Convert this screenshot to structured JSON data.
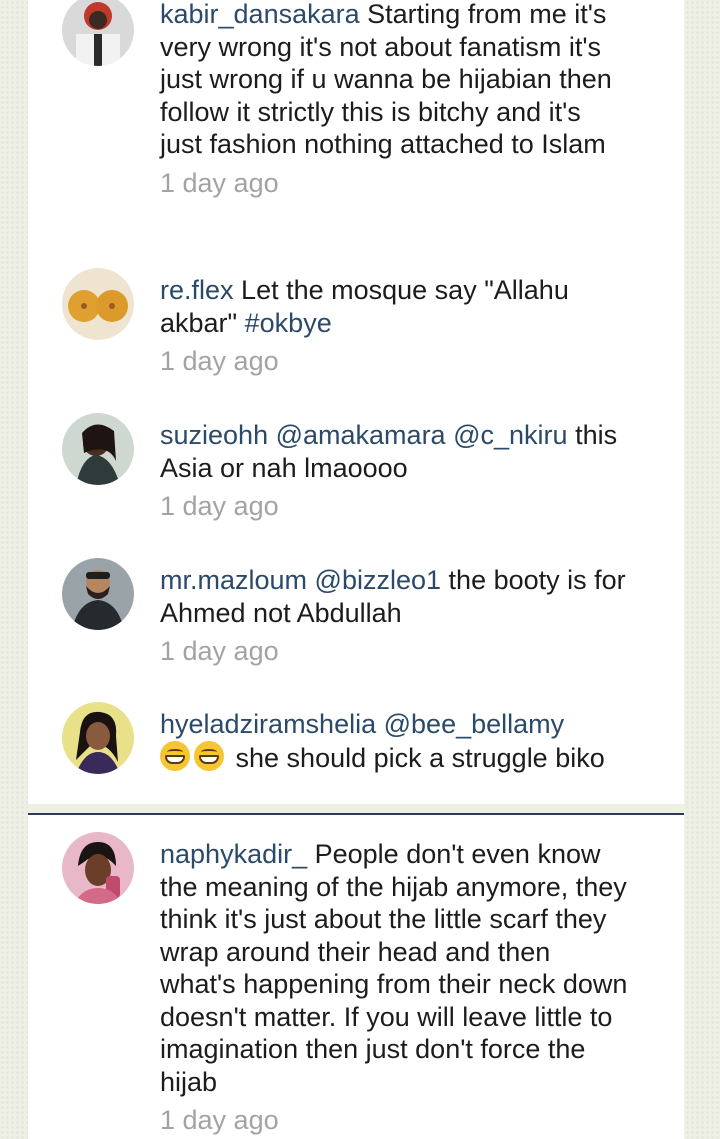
{
  "comments": [
    {
      "username": "kabir_dansakara",
      "text": "Starting from me it's very wrong it's not about fanatism  it's just wrong if u wanna be hijabian then follow it strictly this is bitchy and it's just fashion nothing attached to Islam",
      "time": "1 day ago",
      "avatar": "user-avatar-icon"
    },
    {
      "username": "re.flex",
      "text": "Let the mosque say \"Allahu akbar\"",
      "hashtag": "#okbye",
      "time": "1 day ago",
      "avatar": "user-avatar-icon"
    },
    {
      "username": "suzieohh",
      "mention1": "@amakamara",
      "mention2": "@c_nkiru",
      "text": "this Asia or nah lmaoooo",
      "time": "1 day ago",
      "avatar": "user-avatar-icon"
    },
    {
      "username": "mr.mazloum",
      "mention1": "@bizzleo1",
      "text": "the booty is for Ahmed not Abdullah",
      "time": "1 day ago",
      "avatar": "user-avatar-icon"
    },
    {
      "username": "hyeladziramshelia",
      "mention1": "@bee_bellamy",
      "emoji": "grinning-face-emoji",
      "text": "she should pick a struggle biko",
      "avatar": "user-avatar-icon"
    },
    {
      "username": "naphykadir_",
      "text": "People don't even know the meaning of the hijab anymore, they think it's just about the little scarf they wrap around their head and then what's happening from their neck down doesn't matter. If you will leave little to imagination then just don't force the hijab",
      "time": "1 day ago",
      "avatar": "user-avatar-icon"
    }
  ],
  "colors": {
    "username": "#2b4a6a",
    "timestamp": "#a3a3a3",
    "divider": "#2e3a55",
    "background": "#eef0e6"
  }
}
